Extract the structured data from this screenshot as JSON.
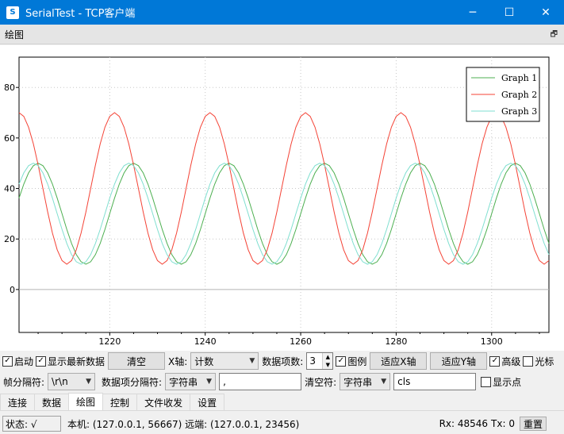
{
  "window": {
    "title": "SerialTest - TCP客户端",
    "app_icon": "serial-app-icon",
    "controls": {
      "minimize": "─",
      "maximize": "☐",
      "close": "✕"
    }
  },
  "dock": {
    "title": "绘图",
    "float_icon": "🗗"
  },
  "toolbar1": {
    "enable_label": "启动",
    "enable_checked": true,
    "show_latest_label": "显示最新数据",
    "show_latest_checked": true,
    "clear_button": "清空",
    "x_axis_label": "X轴:",
    "x_axis_mode": "计数",
    "item_count_label": "数据项数:",
    "item_count_value": "3",
    "legend_label": "图例",
    "legend_checked": true,
    "fit_x_button": "适应X轴",
    "fit_y_button": "适应Y轴",
    "advanced_label": "高级",
    "advanced_checked": true,
    "cursor_label": "光标",
    "cursor_checked": false
  },
  "toolbar2": {
    "frame_sep_label": "帧分隔符:",
    "frame_sep_value": "\\r\\n",
    "item_sep_label": "数据项分隔符:",
    "item_sep_type": "字符串",
    "item_sep_value": ",",
    "clear_char_label": "清空符:",
    "clear_char_type": "字符串",
    "clear_char_value": "cls",
    "show_points_label": "显示点",
    "show_points_checked": false
  },
  "tabs": [
    {
      "label": "连接",
      "active": false
    },
    {
      "label": "数据",
      "active": false
    },
    {
      "label": "绘图",
      "active": true
    },
    {
      "label": "控制",
      "active": false
    },
    {
      "label": "文件收发",
      "active": false
    },
    {
      "label": "设置",
      "active": false
    }
  ],
  "status": {
    "state": "状态: √",
    "connection": "本机: (127.0.0.1, 56667) 远端: (127.0.0.1, 23456)",
    "rx": "Rx: 48546",
    "tx": "Tx: 0",
    "reset": "重置"
  },
  "chart_data": {
    "type": "line",
    "title": "",
    "xlabel": "",
    "ylabel": "",
    "xlim": [
      1201,
      1312
    ],
    "ylim": [
      -17,
      92
    ],
    "xticks": [
      1220,
      1240,
      1260,
      1280,
      1300
    ],
    "yticks": [
      0,
      20,
      40,
      60,
      80
    ],
    "grid": true,
    "legend": "top-right",
    "series": [
      {
        "name": "Graph 1",
        "color": "#4caf50",
        "amplitude": 20,
        "offset": 30,
        "period": 20,
        "phase_peak_x": 1205
      },
      {
        "name": "Graph 2",
        "color": "#f44336",
        "amplitude": 30,
        "offset": 40,
        "period": 20,
        "phase_peak_x": 1201
      },
      {
        "name": "Graph 3",
        "color": "#7fdfd0",
        "amplitude": 20,
        "offset": 30,
        "period": 20,
        "phase_peak_x": 1204
      }
    ]
  }
}
